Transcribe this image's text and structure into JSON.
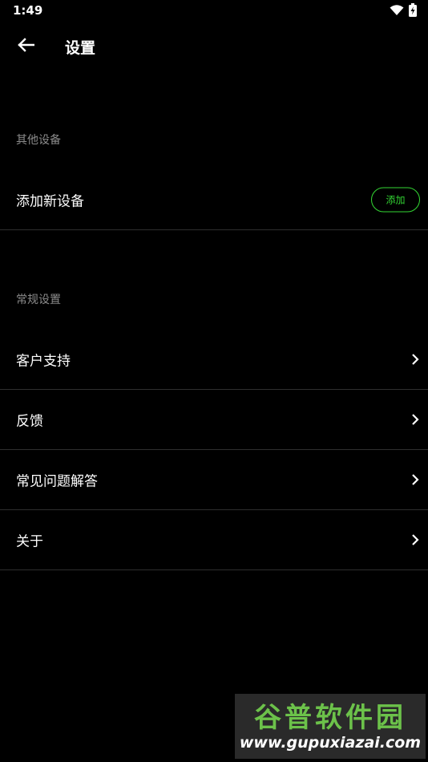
{
  "status_bar": {
    "time": "1:49",
    "icons": [
      "wifi-icon",
      "battery-icon"
    ]
  },
  "header": {
    "title": "设置",
    "back_icon": "arrow-left-icon"
  },
  "sections": {
    "other_devices": {
      "header": "其他设备",
      "add_device": {
        "label": "添加新设备",
        "button_label": "添加"
      }
    },
    "general": {
      "header": "常规设置",
      "items": [
        {
          "label": "客户支持",
          "icon": "chevron-right-icon"
        },
        {
          "label": "反馈",
          "icon": "chevron-right-icon"
        },
        {
          "label": "常见问题解答",
          "icon": "chevron-right-icon"
        },
        {
          "label": "关于",
          "icon": "chevron-right-icon"
        }
      ]
    }
  },
  "watermark": {
    "logo_text": "谷普软件园",
    "url": "www.gupuxiazai.com"
  },
  "colors": {
    "background": "#000000",
    "accent": "#33d633",
    "divider": "#2e2e2e",
    "section_header": "#8c8c8c"
  }
}
